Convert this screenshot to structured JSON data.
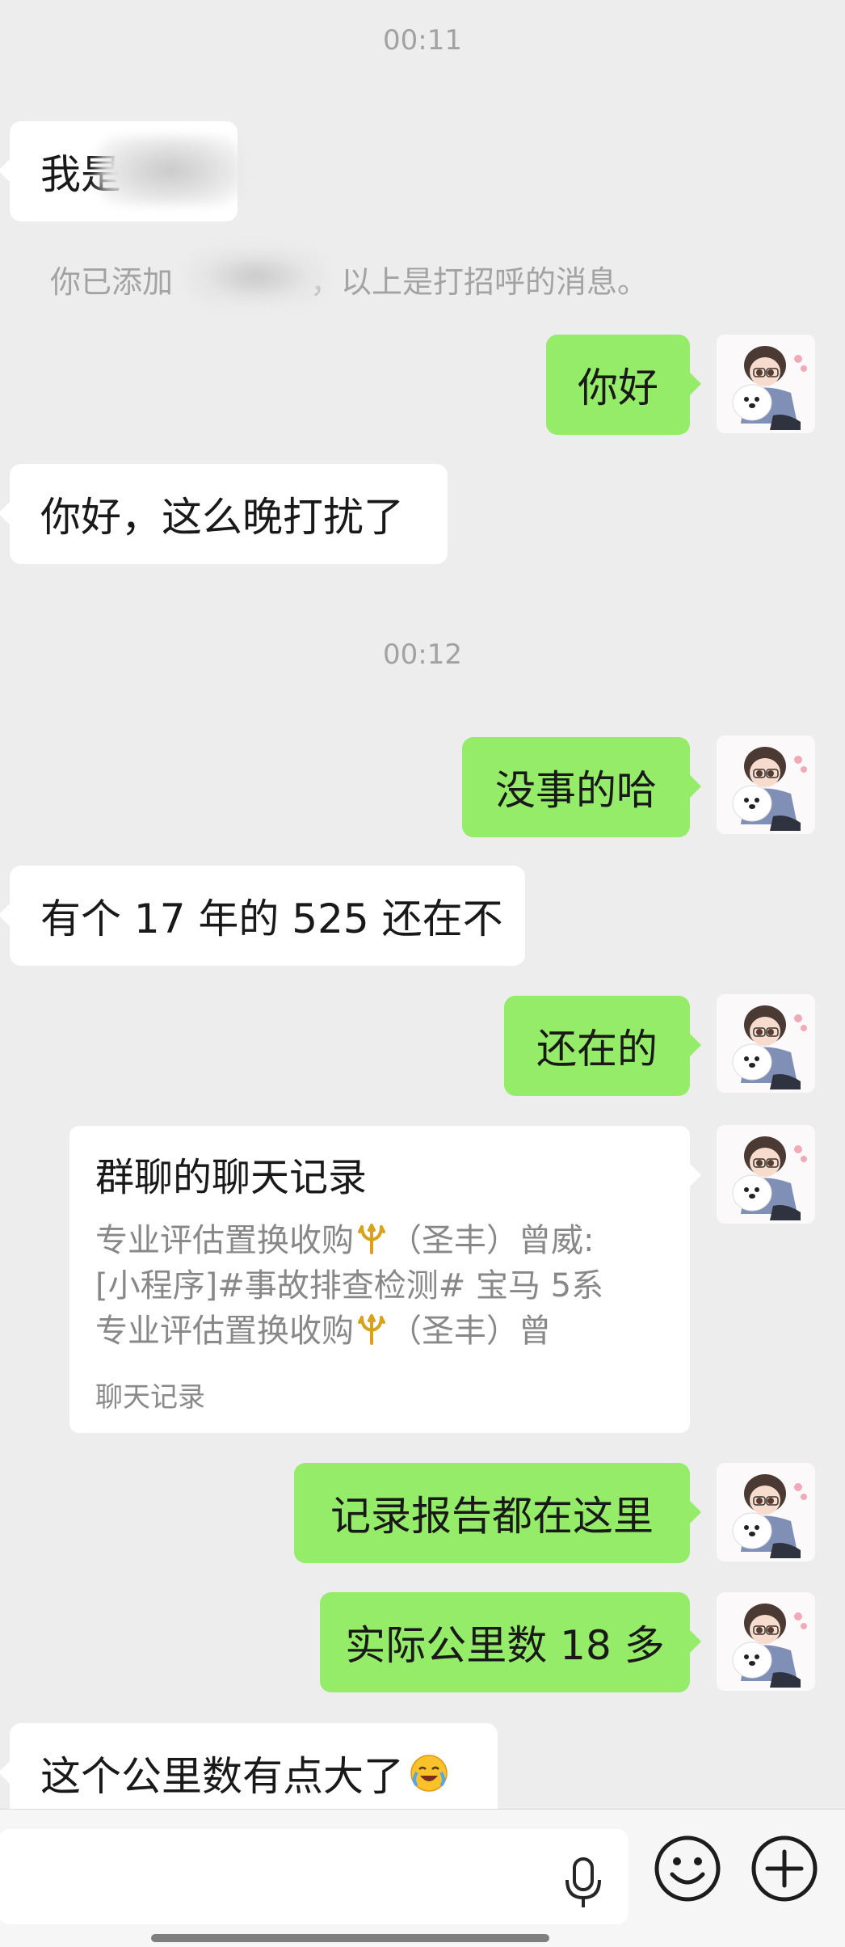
{
  "timestamps": [
    "00:11",
    "00:12"
  ],
  "system_notice": {
    "prefix": "你已添加",
    "suffix": "，以上是打招呼的消息。"
  },
  "messages": [
    {
      "side": "in",
      "text": "我是"
    },
    {
      "side": "out",
      "text": "你好"
    },
    {
      "side": "in",
      "text": "你好，这么晚打扰了"
    },
    {
      "side": "out",
      "text": "没事的哈"
    },
    {
      "side": "in",
      "text": "有个 17 年的 525 还在不"
    },
    {
      "side": "out",
      "text": "还在的"
    },
    {
      "side": "out",
      "text": "记录报告都在这里"
    },
    {
      "side": "out",
      "text": "实际公里数 18 多"
    },
    {
      "side": "in",
      "text": "这个公里数有点大了"
    }
  ],
  "chat_record_card": {
    "title": "群聊的聊天记录",
    "line1_a": "专业评估置换收购",
    "line1_b": "（圣丰）曾威:",
    "line2": "[小程序]#事故排查检测# 宝马 5系",
    "line3_a": "专业评估置换收购",
    "line3_b": "（圣丰）曾",
    "footer": "聊天记录"
  },
  "icons": {
    "voice": "microphone-icon",
    "emoji": "smiley-icon",
    "more": "plus-circle-icon"
  },
  "colors": {
    "background": "#ededed",
    "outgoing_bubble": "#95ec69",
    "incoming_bubble": "#ffffff"
  }
}
